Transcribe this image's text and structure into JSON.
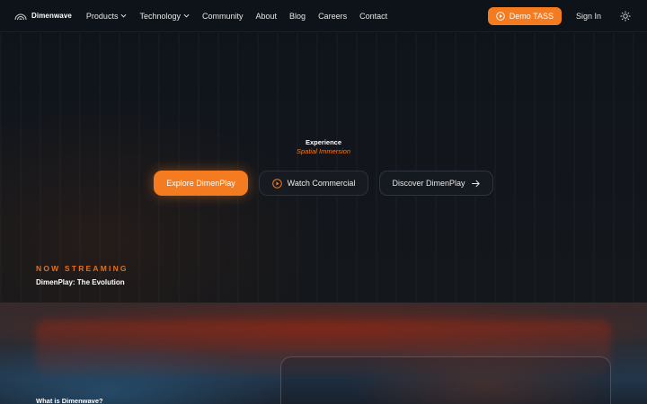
{
  "brand": {
    "name": "Dimenwave",
    "icon": "dimenwave-logo-icon"
  },
  "nav": {
    "items": [
      {
        "label": "Products",
        "has_dropdown": true
      },
      {
        "label": "Technology",
        "has_dropdown": true
      },
      {
        "label": "Community",
        "has_dropdown": false
      },
      {
        "label": "About",
        "has_dropdown": false
      },
      {
        "label": "Blog",
        "has_dropdown": false
      },
      {
        "label": "Careers",
        "has_dropdown": false
      },
      {
        "label": "Contact",
        "has_dropdown": false
      }
    ],
    "demo_button": {
      "label": "Demo TASS",
      "icon": "play-circle-icon"
    },
    "sign_in": "Sign In",
    "theme_toggle_icon": "sun-icon"
  },
  "hero": {
    "line1": "Experience",
    "line2": "Spatial Immersion",
    "buttons": {
      "explore": "Explore DimenPlay",
      "watch": {
        "label": "Watch Commercial",
        "icon": "play-circle-icon"
      },
      "discover": {
        "label": "Discover DimenPlay",
        "icon": "arrow-right-icon"
      }
    },
    "now_streaming": "NOW STREAMING",
    "now_title": "DimenPlay: The Evolution"
  },
  "section": {
    "label": "What is Dimenwave?"
  },
  "colors": {
    "accent": "#f47b20",
    "background": "#0d1117",
    "nav_background": "#0e131a"
  }
}
